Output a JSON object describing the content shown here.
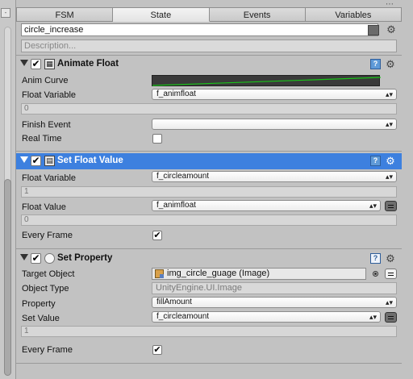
{
  "tabs": [
    "FSM",
    "State",
    "Events",
    "Variables"
  ],
  "state": {
    "name": "circle_increase",
    "description_placeholder": "Description..."
  },
  "actions": [
    {
      "title": "Animate Float",
      "anim_curve_label": "Anim Curve",
      "float_variable_label": "Float Variable",
      "float_variable_value": "f_animfloat",
      "float_variable_sub": "0",
      "finish_event_label": "Finish Event",
      "finish_event_value": "",
      "real_time_label": "Real Time",
      "real_time_checked": false,
      "curve_color": "#19c419"
    },
    {
      "title": "Set Float Value",
      "selected": true,
      "float_variable_label": "Float Variable",
      "float_variable_value": "f_circleamount",
      "float_variable_sub": "1",
      "float_value_label": "Float Value",
      "float_value_value": "f_animfloat",
      "float_value_sub": "0",
      "every_frame_label": "Every Frame",
      "every_frame_checked": true,
      "highlight_color": "#3d80df"
    },
    {
      "title": "Set Property",
      "target_object_label": "Target Object",
      "target_object_value": "img_circle_guage (Image)",
      "object_type_label": "Object Type",
      "object_type_value": "UnityEngine.UI.Image",
      "property_label": "Property",
      "property_value": "fillAmount",
      "set_value_label": "Set Value",
      "set_value_value": "f_circleamount",
      "set_value_sub": "1",
      "every_frame_label": "Every Frame",
      "every_frame_checked": true
    }
  ],
  "icons": {
    "gear": "⚙",
    "help": "?",
    "check": "✔",
    "select_arrows": "▴▾",
    "more": "⋯"
  }
}
